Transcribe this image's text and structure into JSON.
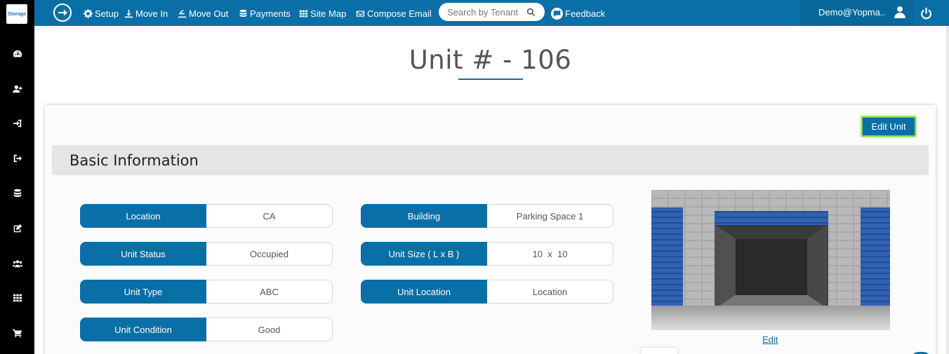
{
  "sidebar": {
    "logo_text": "Storage",
    "icons": [
      "dashboard-icon",
      "add-user-icon",
      "move-in-icon",
      "move-out-icon",
      "database-icon",
      "edit-icon",
      "users-icon",
      "grid-icon",
      "cart-icon"
    ]
  },
  "topbar": {
    "nav": [
      {
        "label": "Setup",
        "icon": "gear-icon"
      },
      {
        "label": "Move In",
        "icon": "move-in-icon"
      },
      {
        "label": "Move Out",
        "icon": "move-out-icon"
      },
      {
        "label": "Payments",
        "icon": "database-icon"
      },
      {
        "label": "Site Map",
        "icon": "grid-icon"
      },
      {
        "label": "Compose Email",
        "icon": "envelope-icon"
      }
    ],
    "search_placeholder": "Search by Tenant",
    "feedback_label": "Feedback",
    "user_name": "Demo@Yopma.."
  },
  "page": {
    "title": "Unit # - 106"
  },
  "card": {
    "edit_unit_label": "Edit Unit",
    "section_title": "Basic Information",
    "fields_left": [
      {
        "label": "Location",
        "value": "CA"
      },
      {
        "label": "Unit Status",
        "value": "Occupied"
      },
      {
        "label": "Unit Type",
        "value": "ABC"
      },
      {
        "label": "Unit Condition",
        "value": "Good"
      }
    ],
    "fields_right": [
      {
        "label": "Building",
        "value": "Parking Space 1"
      },
      {
        "label": "Unit Size ( L x B )",
        "value": "10  x  10"
      },
      {
        "label": "Unit Location",
        "value": "Location"
      }
    ],
    "photo_edit_label": "Edit"
  },
  "colors": {
    "primary": "#0a6fa6",
    "sidebar": "#000000",
    "highlight": "#87d23c"
  }
}
